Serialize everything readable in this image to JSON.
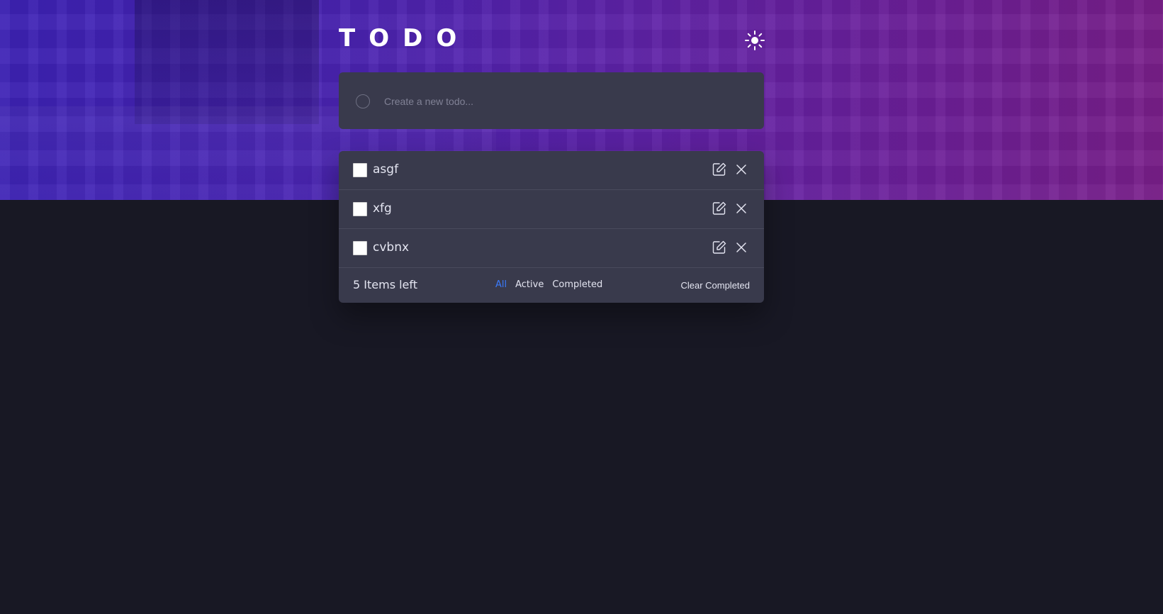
{
  "header": {
    "title": "TODO",
    "theme_icon": "sun-icon"
  },
  "new_todo": {
    "placeholder": "Create a new todo..."
  },
  "todos": [
    {
      "text": "asgf",
      "completed": false
    },
    {
      "text": "xfg",
      "completed": false
    },
    {
      "text": "cvbnx",
      "completed": false
    }
  ],
  "footer": {
    "items_left": "5 Items left",
    "filters": [
      "All",
      "Active",
      "Completed"
    ],
    "active_filter": "All",
    "clear_label": "Clear Completed"
  },
  "colors": {
    "background": "#181824",
    "card": "#393a4c",
    "accent": "#3a7bfd",
    "text": "#e4e5f1"
  }
}
